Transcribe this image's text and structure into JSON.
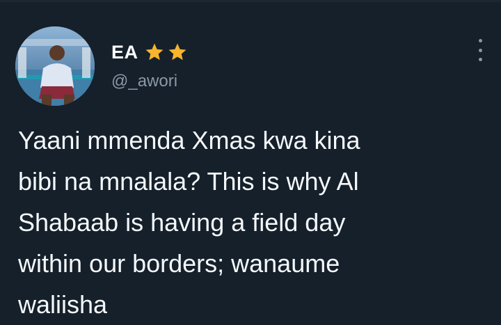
{
  "user": {
    "display_name": "EA",
    "handle": "@_awori",
    "badges": [
      "star-icon",
      "star-icon"
    ],
    "badge_color": "#f7b42c"
  },
  "tweet": {
    "lines": [
      "Yaani mmenda Xmas kwa kina",
      "bibi na mnalala? This is why Al",
      "Shabaab is having a field day",
      "within our borders; wanaume",
      "waliisha"
    ]
  },
  "menu": {
    "icon": "more-options-icon"
  },
  "colors": {
    "background": "#15202b",
    "text": "#f5f8fa",
    "secondary_text": "#8b98a5"
  }
}
